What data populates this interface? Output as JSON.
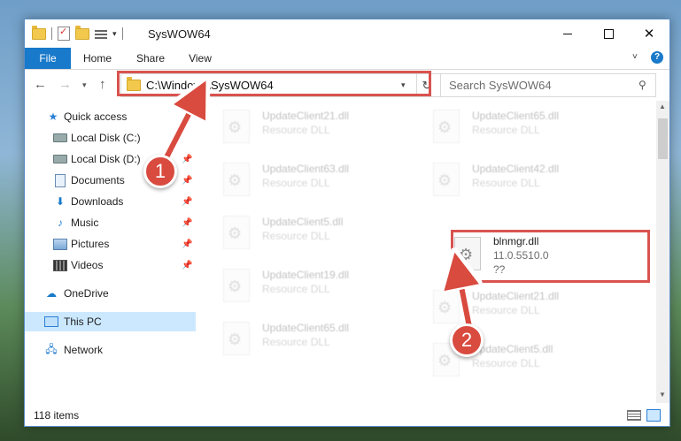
{
  "window": {
    "title": "SysWOW64",
    "controls": {
      "minimize": "minimize",
      "maximize": "maximize",
      "close": "✕"
    }
  },
  "ribbon": {
    "tabs": [
      {
        "label": "File"
      },
      {
        "label": "Home"
      },
      {
        "label": "Share"
      },
      {
        "label": "View"
      }
    ],
    "help": "?"
  },
  "address": {
    "path": "C:\\Windows\\SysWOW64",
    "refresh": "↻"
  },
  "search": {
    "placeholder": "Search SysWOW64"
  },
  "sidebar": {
    "quick_access": "Quick access",
    "items": [
      {
        "label": "Local Disk (C:)"
      },
      {
        "label": "Local Disk (D:)"
      },
      {
        "label": "Documents"
      },
      {
        "label": "Downloads"
      },
      {
        "label": "Music"
      },
      {
        "label": "Pictures"
      },
      {
        "label": "Videos"
      }
    ],
    "onedrive": "OneDrive",
    "this_pc": "This PC",
    "network": "Network"
  },
  "files": {
    "left": [
      {
        "name": "UpdateClient21.dll",
        "type": "Resource DLL"
      },
      {
        "name": "UpdateClient63.dll",
        "type": "Resource DLL"
      },
      {
        "name": "UpdateClient5.dll",
        "type": "Resource DLL"
      },
      {
        "name": "UpdateClient19.dll",
        "type": "Resource DLL"
      },
      {
        "name": "UpdateClient65.dll",
        "type": "Resource DLL"
      }
    ],
    "right": [
      {
        "name": "UpdateClient65.dll",
        "type": "Resource DLL"
      },
      {
        "name": "UpdateClient42.dll",
        "type": "Resource DLL"
      },
      {
        "name": "UpdateClient21.dll",
        "type": "Resource DLL"
      },
      {
        "name": "UpdateClient5.dll",
        "type": "Resource DLL"
      }
    ],
    "highlighted": {
      "name": "blnmgr.dll",
      "version": "11.0.5510.0",
      "description": "??"
    }
  },
  "status": {
    "items": "118 items"
  },
  "annotations": {
    "step1": "1",
    "step2": "2"
  },
  "colors": {
    "accent": "#1979ca",
    "highlight": "#d9534f",
    "selected": "#cce8ff"
  }
}
